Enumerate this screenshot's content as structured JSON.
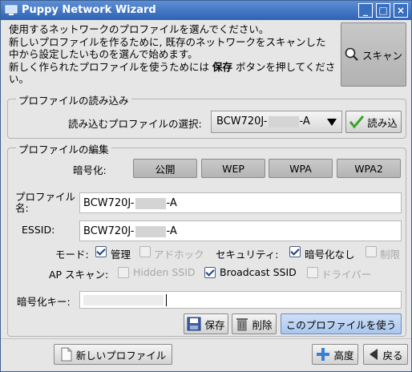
{
  "window": {
    "title": "Puppy Network Wizard"
  },
  "description": {
    "line1": "使用するネットワークのプロファイルを選んでください。",
    "line2": "新しいプロファイルを作るために, 既存のネットワークをスキャンした",
    "line3": "中から設定したいものを選んで始めます。",
    "line4_pre": "新しく作られたプロファイルを使うためには ",
    "line4_bold": "保存",
    "line4_post": " ボタンを押してくださ",
    "line5": "い。"
  },
  "scan_button": {
    "label": "スキャン"
  },
  "load_section": {
    "title": "プロファイルの読み込み",
    "select_label": "読み込むプロファイルの選択:",
    "selected_prefix": "BCW720J-",
    "selected_suffix": "-A",
    "load_button": "読み込"
  },
  "edit_section": {
    "title": "プロファイルの編集",
    "encryption_label": "暗号化:",
    "encryption_buttons": [
      "公開",
      "WEP",
      "WPA",
      "WPA2"
    ],
    "profile_name_label_1": "プロファイル",
    "profile_name_label_2": "名:",
    "profile_name_prefix": "BCW720J-",
    "profile_name_suffix": "-A",
    "essid_label": "ESSID:",
    "essid_prefix": "BCW720J-",
    "essid_suffix": "-A",
    "mode_label": "モード:",
    "mode_managed": "管理",
    "mode_adhoc": "アドホック",
    "security_label": "セキュリティ:",
    "security_none": "暗号化なし",
    "security_restricted": "制限",
    "ap_scan_label": "AP スキャン:",
    "hidden_ssid": "Hidden SSID",
    "broadcast_ssid": "Broadcast SSID",
    "driver": "ドライバー",
    "key_label": "暗号化キー:",
    "save_button": "保存",
    "delete_button": "削除",
    "use_profile_button": "このプロファイルを使う"
  },
  "footer": {
    "new_profile_button": "新しいプロファイル",
    "advanced_button": "高度",
    "back_button": "戻る"
  },
  "checkbox_states": {
    "mode_managed": true,
    "mode_adhoc": false,
    "security_none": true,
    "security_restricted": false,
    "hidden_ssid": false,
    "broadcast_ssid": true,
    "driver": false
  },
  "colors": {
    "titlebar": "#2f63b3",
    "accent_blue": "#a9c6ee",
    "check_green": "#3aa32a"
  },
  "icons": [
    "network-icon",
    "minimize-icon",
    "maximize-icon",
    "close-icon",
    "scan-icon",
    "checkmark-icon",
    "save-icon",
    "trash-icon",
    "document-icon",
    "plus-icon",
    "back-arrow-icon"
  ]
}
